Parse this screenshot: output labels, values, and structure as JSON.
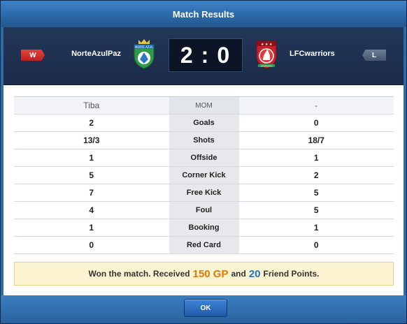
{
  "title": "Match Results",
  "home": {
    "result_tag": "W",
    "name": "NorteAzulPaz",
    "crest_text": "NORTE AZUL",
    "mom": "Tiba"
  },
  "away": {
    "result_tag": "L",
    "name": "LFCwarriors",
    "crest_text": "WARRIORS",
    "mom": "-"
  },
  "score": {
    "home": "2",
    "separator": ":",
    "away": "0"
  },
  "mom_label": "MOM",
  "stats": [
    {
      "label": "Goals",
      "home": "2",
      "away": "0"
    },
    {
      "label": "Shots",
      "home": "13/3",
      "away": "18/7"
    },
    {
      "label": "Offside",
      "home": "1",
      "away": "1"
    },
    {
      "label": "Corner Kick",
      "home": "5",
      "away": "2"
    },
    {
      "label": "Free Kick",
      "home": "7",
      "away": "5"
    },
    {
      "label": "Foul",
      "home": "4",
      "away": "5"
    },
    {
      "label": "Booking",
      "home": "1",
      "away": "1"
    },
    {
      "label": "Red Card",
      "home": "0",
      "away": "0"
    }
  ],
  "reward": {
    "prefix": "Won the match. Received",
    "gp_amount": "150 GP",
    "middle": "and",
    "fp_amount": "20",
    "suffix": "Friend Points."
  },
  "ok_label": "OK",
  "colors": {
    "win": "#d3312a",
    "loss": "#56667f",
    "gp": "#e07a00",
    "fp": "#1e74c8"
  }
}
